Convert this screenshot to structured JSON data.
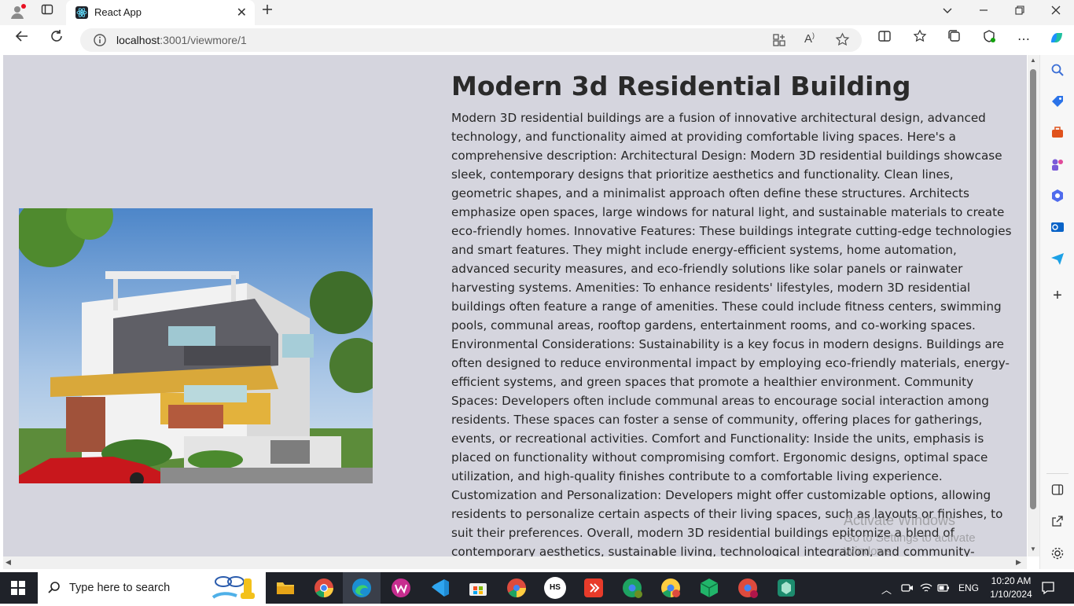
{
  "browser": {
    "tab_title": "React App",
    "url_host": "localhost",
    "url_path": ":3001/viewmore/1"
  },
  "page": {
    "title": "Modern 3d Residential Building",
    "description": "Modern 3D residential buildings are a fusion of innovative architectural design, advanced technology, and functionality aimed at providing comfortable living spaces. Here's a comprehensive description: Architectural Design: Modern 3D residential buildings showcase sleek, contemporary designs that prioritize aesthetics and functionality. Clean lines, geometric shapes, and a minimalist approach often define these structures. Architects emphasize open spaces, large windows for natural light, and sustainable materials to create eco-friendly homes. Innovative Features: These buildings integrate cutting-edge technologies and smart features. They might include energy-efficient systems, home automation, advanced security measures, and eco-friendly solutions like solar panels or rainwater harvesting systems. Amenities: To enhance residents' lifestyles, modern 3D residential buildings often feature a range of amenities. These could include fitness centers, swimming pools, communal areas, rooftop gardens, entertainment rooms, and co-working spaces. Environmental Considerations: Sustainability is a key focus in modern designs. Buildings are often designed to reduce environmental impact by employing eco-friendly materials, energy-efficient systems, and green spaces that promote a healthier environment. Community Spaces: Developers often include communal areas to encourage social interaction among residents. These spaces can foster a sense of community, offering places for gatherings, events, or recreational activities. Comfort and Functionality: Inside the units, emphasis is placed on functionality without compromising comfort. Ergonomic designs, optimal space utilization, and high-quality finishes contribute to a comfortable living experience. Customization and Personalization: Developers might offer customizable options, allowing residents to personalize certain aspects of their living spaces, such as layouts or finishes, to suit their preferences. Overall, modern 3D residential buildings epitomize a blend of contemporary aesthetics, sustainable living, technological integration, and community-centric design, catering to the evolving needs and preferences of residents."
  },
  "windows": {
    "watermark_title": "Activate Windows",
    "watermark_sub": "Go to Settings to activate Windows."
  },
  "taskbar": {
    "search_placeholder": "Type here to search",
    "language": "ENG",
    "time": "10:20 AM",
    "date": "1/10/2024",
    "hs_label": "HS"
  },
  "colors": {
    "page_bg": "#d5d5de",
    "taskbar_bg": "#1f2229"
  }
}
